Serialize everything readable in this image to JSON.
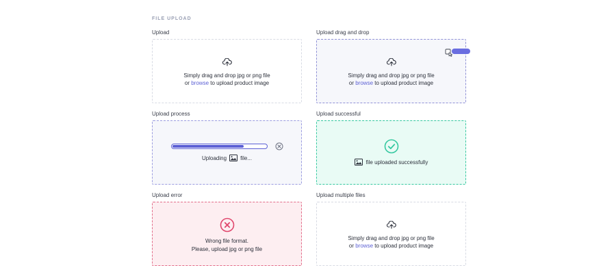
{
  "section_title": "FILE UPLOAD",
  "upload": {
    "label": "Upload",
    "line1": "Simply drag and drop jpg or png file",
    "line2_prefix": "or",
    "browse": "browse",
    "line2_suffix": "to upload product image"
  },
  "drag": {
    "label": "Upload drag and drop",
    "line1": "Simply drag and drop jpg or png file",
    "line2_prefix": "or",
    "browse": "browse",
    "line2_suffix": "to upload product image"
  },
  "process": {
    "label": "Upload process",
    "uploading": "Uploading",
    "file": "file...",
    "progress_percent": 76
  },
  "success": {
    "label": "Upload successful",
    "message": "file uploaded successfully"
  },
  "error": {
    "label": "Upload error",
    "line1": "Wrong file format.",
    "line2": "Please, upload jpg or png file"
  },
  "multiple": {
    "label": "Upload multiple files",
    "line1": "Simply drag and drop jpg or png file",
    "line2_prefix": "or",
    "browse": "browse",
    "line2_suffix": "to upload product image"
  },
  "colors": {
    "accent": "#5b5fd4",
    "success": "#35c8a0",
    "error": "#e0466c"
  }
}
